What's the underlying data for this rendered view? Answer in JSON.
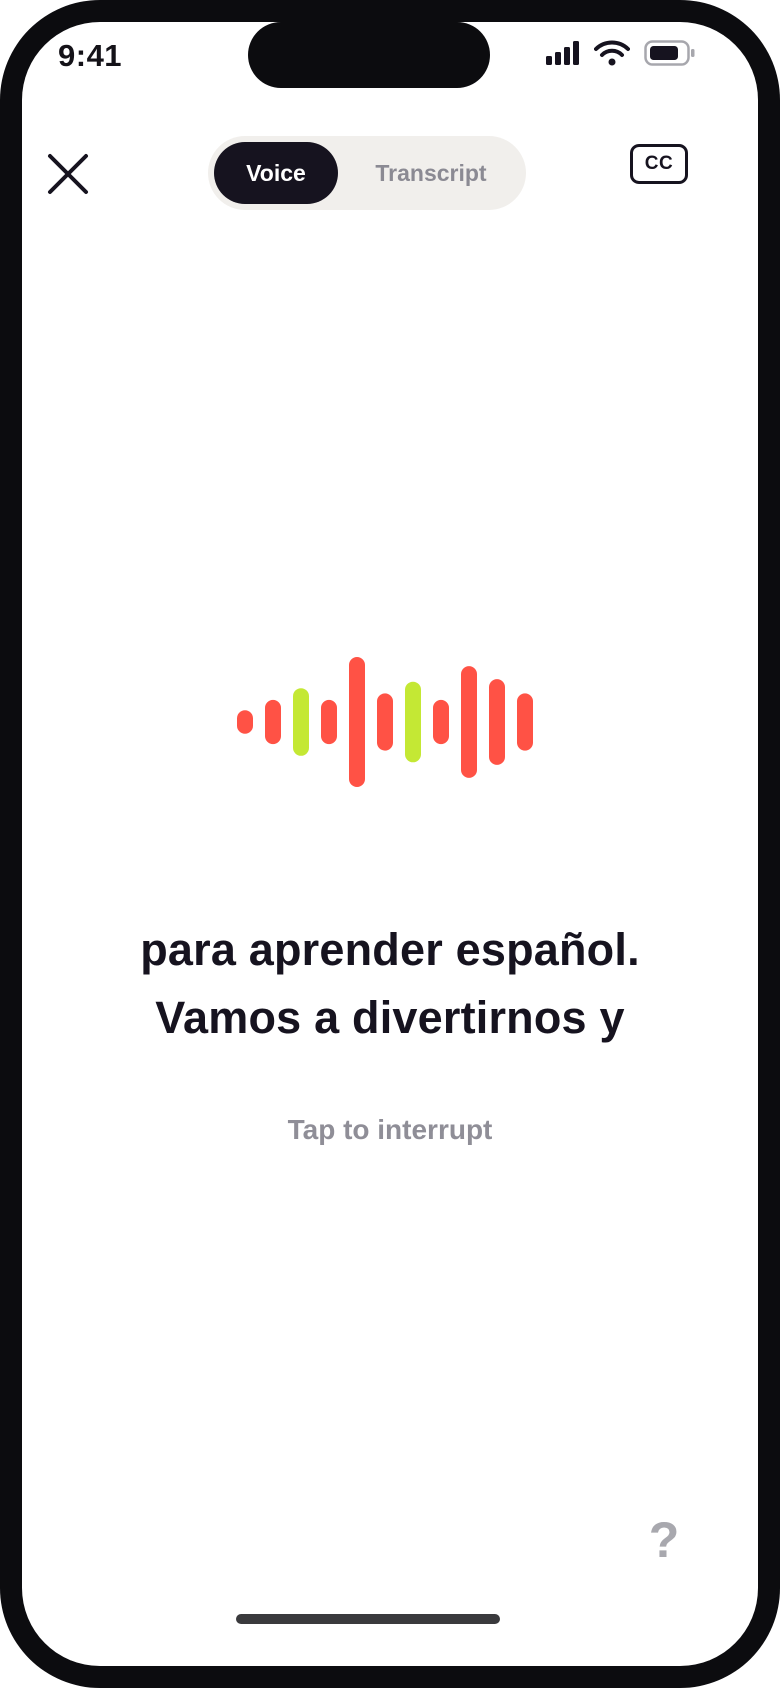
{
  "status_bar": {
    "time": "9:41",
    "signal_icon": "cellular-signal-icon",
    "wifi_icon": "wifi-icon",
    "battery_icon": "battery-icon"
  },
  "header": {
    "close_icon": "close-icon",
    "mode_toggle": {
      "options": [
        "Voice",
        "Transcript"
      ],
      "selected": "Voice"
    },
    "captions_button_label": "CC"
  },
  "waveform": {
    "icon": "audio-waveform-icon",
    "colors": {
      "primary": "#ff5245",
      "accent": "#c4e834"
    },
    "bars": [
      {
        "level": 0.18,
        "color": "primary"
      },
      {
        "level": 0.34,
        "color": "primary"
      },
      {
        "level": 0.52,
        "color": "accent"
      },
      {
        "level": 0.34,
        "color": "primary"
      },
      {
        "level": 1.0,
        "color": "primary"
      },
      {
        "level": 0.44,
        "color": "primary"
      },
      {
        "level": 0.62,
        "color": "accent"
      },
      {
        "level": 0.34,
        "color": "primary"
      },
      {
        "level": 0.86,
        "color": "primary"
      },
      {
        "level": 0.66,
        "color": "primary"
      },
      {
        "level": 0.44,
        "color": "primary"
      }
    ]
  },
  "caption": {
    "line1": "para aprender español.",
    "line2": "Vamos a divertirnos y"
  },
  "hint": "Tap to interrupt",
  "help_label": "?",
  "colors": {
    "text_dark": "#16131f",
    "text_muted": "#8f8e97",
    "segment_bg": "#f1efec"
  }
}
